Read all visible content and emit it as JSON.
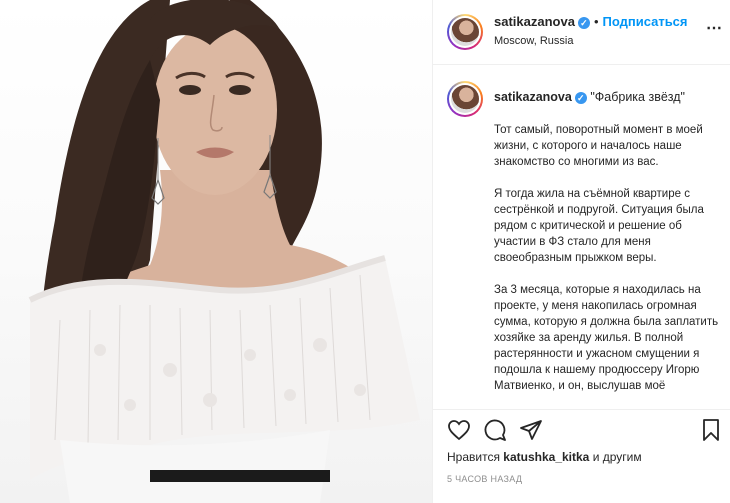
{
  "post": {
    "header": {
      "username": "satikazanova",
      "separator": "•",
      "follow_label": "Подписаться",
      "location": "Moscow, Russia",
      "more_icon": "more-options-icon"
    },
    "caption": {
      "username": "satikazanova",
      "title": "\"Фабрика звёзд\"",
      "paragraphs": [
        "Тот самый, поворотный момент в моей жизни, с которого и началось наше знакомство со многими из вас.",
        "Я тогда жила на съёмной квартире с сестрёнкой и подругой. Ситуация была рядом с критической и решение об участии в ФЗ стало для меня своеобразным прыжком веры.",
        "За 3 месяца, которые я находилась на проекте, у меня накопилась огромная сумма, которую я должна была заплатить хозяйке за аренду жилья. В полной растерянности и ужасном смущении я подошла к нашему продюссеру Игорю Матвиенко, и он, выслушав моё"
      ]
    },
    "actions": {
      "like_icon": "heart-icon",
      "comment_icon": "comment-icon",
      "share_icon": "share-icon",
      "save_icon": "bookmark-icon"
    },
    "likes": {
      "prefix": "Нравится",
      "user": "katushka_kitka",
      "suffix": "и другим"
    },
    "timestamp": "5 часов назад",
    "colors": {
      "link_blue": "#0095f6",
      "verified_blue": "#3897f0",
      "border": "#efefef",
      "muted": "#8e8e8e"
    }
  }
}
